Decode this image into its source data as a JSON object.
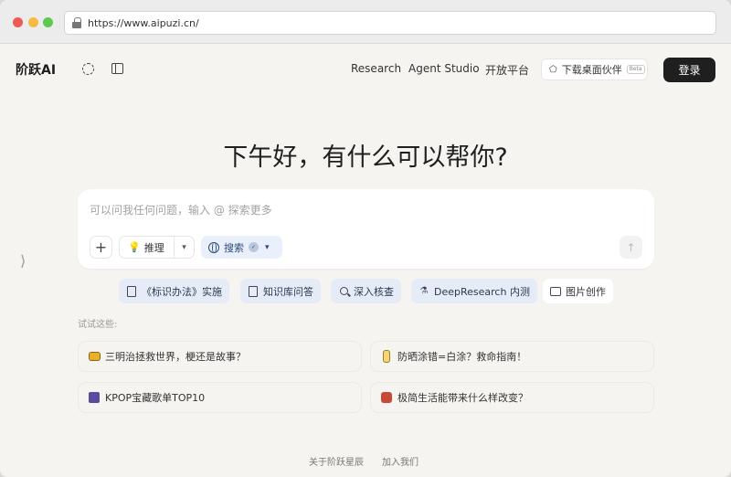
{
  "browser": {
    "url": "https://www.aipuzi.cn/"
  },
  "header": {
    "brand": "阶跃AI",
    "nav": [
      "Research",
      "Agent Studio",
      "开放平台"
    ],
    "download_label": "下载桌面伙伴",
    "download_badge": "Beta",
    "login_label": "登录"
  },
  "main": {
    "greeting": "下午好，有什么可以帮你?",
    "input_placeholder": "可以问我任何问题，输入 @ 探索更多",
    "reasoning_label": "推理",
    "search_label": "搜索",
    "search_badge": "✓"
  },
  "tools": [
    {
      "label": "《标识办法》实施",
      "icon": "book-icon"
    },
    {
      "label": "知识库问答",
      "icon": "library-icon"
    },
    {
      "label": "深入核查",
      "icon": "magnifier-icon"
    },
    {
      "label": "DeepResearch 内测",
      "icon": "flask-icon"
    },
    {
      "label": "图片创作",
      "icon": "image-icon"
    }
  ],
  "suggestions": {
    "label": "试试这些:",
    "items": [
      {
        "text": "三明治拯救世界，梗还是故事？",
        "icon": "sandwich-icon"
      },
      {
        "text": "防晒涂错=白涂？救命指南！",
        "icon": "sunscreen-icon"
      },
      {
        "text": "KPOP宝藏歌单TOP10",
        "icon": "music-box-icon"
      },
      {
        "text": "极简生活能带来什么样改变？",
        "icon": "backpack-icon"
      }
    ]
  },
  "footer": {
    "about": "关于阶跃星辰",
    "join": "加入我们"
  }
}
